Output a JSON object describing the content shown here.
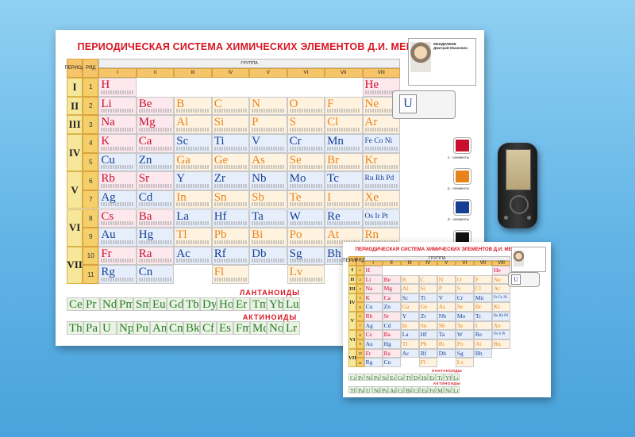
{
  "title": "ПЕРИОДИЧЕСКАЯ СИСТЕМА ХИМИЧЕСКИХ ЭЛЕМЕНТОВ Д.И. МЕНДЕЛЕЕВА",
  "header": {
    "period_label": "ПЕРИОД",
    "row_label": "РЯД",
    "group_label": "ГРУППА"
  },
  "groups": [
    "I",
    "II",
    "III",
    "IV",
    "V",
    "VI",
    "VII",
    "VIII"
  ],
  "portrait": {
    "name_line1": "МЕНДЕЛЕЕВ",
    "name_line2": "Дмитрий Иванович"
  },
  "periods": [
    {
      "label": "I",
      "rows": [
        "1"
      ]
    },
    {
      "label": "II",
      "rows": [
        "2"
      ]
    },
    {
      "label": "III",
      "rows": [
        "3"
      ]
    },
    {
      "label": "IV",
      "rows": [
        "4",
        "5"
      ]
    },
    {
      "label": "V",
      "rows": [
        "6",
        "7"
      ]
    },
    {
      "label": "VI",
      "rows": [
        "8",
        "9"
      ]
    },
    {
      "label": "VII",
      "rows": [
        "10",
        "11"
      ]
    }
  ],
  "table_rows": [
    [
      "H",
      "",
      "",
      "",
      "",
      "",
      "",
      "He"
    ],
    [
      "Li",
      "Be",
      "B",
      "C",
      "N",
      "O",
      "F",
      "Ne"
    ],
    [
      "Na",
      "Mg",
      "Al",
      "Si",
      "P",
      "S",
      "Cl",
      "Ar"
    ],
    [
      "K",
      "Ca",
      "Sc",
      "Ti",
      "V",
      "Cr",
      "Mn",
      "Fe Co Ni"
    ],
    [
      "Cu",
      "Zn",
      "Ga",
      "Ge",
      "As",
      "Se",
      "Br",
      "Kr"
    ],
    [
      "Rb",
      "Sr",
      "Y",
      "Zr",
      "Nb",
      "Mo",
      "Tc",
      "Ru Rh Pd"
    ],
    [
      "Ag",
      "Cd",
      "In",
      "Sn",
      "Sb",
      "Te",
      "I",
      "Xe"
    ],
    [
      "Cs",
      "Ba",
      "La",
      "Hf",
      "Ta",
      "W",
      "Re",
      "Os Ir Pt"
    ],
    [
      "Au",
      "Hg",
      "Tl",
      "Pb",
      "Bi",
      "Po",
      "At",
      "Rn"
    ],
    [
      "Fr",
      "Ra",
      "Ac",
      "Rf",
      "Db",
      "Sg",
      "Bh",
      ""
    ],
    [
      "Rg",
      "Cn",
      "",
      "Fl",
      "",
      "Lv",
      "",
      ""
    ]
  ],
  "lanthanides_title": "ЛАНТАНОИДЫ",
  "lanthanides": [
    "Ce",
    "Pr",
    "Nd",
    "Pm",
    "Sm",
    "Eu",
    "Gd",
    "Tb",
    "Dy",
    "Ho",
    "Er",
    "Tm",
    "Yb",
    "Lu"
  ],
  "actinides_title": "АКТИНОИДЫ",
  "actinides": [
    "Th",
    "Pa",
    "U",
    "Np",
    "Pu",
    "Am",
    "Cm",
    "Bk",
    "Cf",
    "Es",
    "Fm",
    "Md",
    "No",
    "Lr"
  ],
  "u_tile": {
    "symbol": "U"
  },
  "legend": [
    {
      "color": "#c8102e",
      "label": "s - элементы"
    },
    {
      "color": "#e8831c",
      "label": "p - элементы"
    },
    {
      "color": "#163f93",
      "label": "d - элементы"
    },
    {
      "color": "#111111",
      "label": "f - элементы"
    }
  ]
}
